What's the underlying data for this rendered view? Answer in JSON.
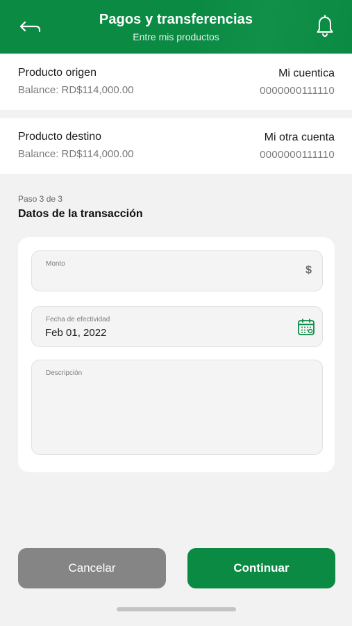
{
  "header": {
    "title": "Pagos y transferencias",
    "subtitle": "Entre mis productos",
    "back_icon": "back-arrow-icon",
    "bell_icon": "bell-icon",
    "brand_color": "#0a8a43"
  },
  "origin": {
    "label": "Producto origen",
    "balance": "Balance: RD$114,000.00",
    "account_name": "Mi cuentica",
    "account_number": "0000000111110"
  },
  "destination": {
    "label": "Producto destino",
    "balance": "Balance: RD$114,000.00",
    "account_name": "Mi otra cuenta",
    "account_number": "0000000111110"
  },
  "step": {
    "label": "Paso 3 de 3",
    "title": "Datos de la transacción"
  },
  "form": {
    "amount": {
      "label": "Monto",
      "value": "",
      "icon": "$"
    },
    "date": {
      "label": "Fecha de efectividad",
      "value": "Feb 01, 2022",
      "icon": "calendar-icon"
    },
    "description": {
      "label": "Descripción",
      "value": ""
    }
  },
  "actions": {
    "cancel_label": "Cancelar",
    "continue_label": "Continuar",
    "cancel_color": "#858585",
    "continue_color": "#0a8a43"
  }
}
